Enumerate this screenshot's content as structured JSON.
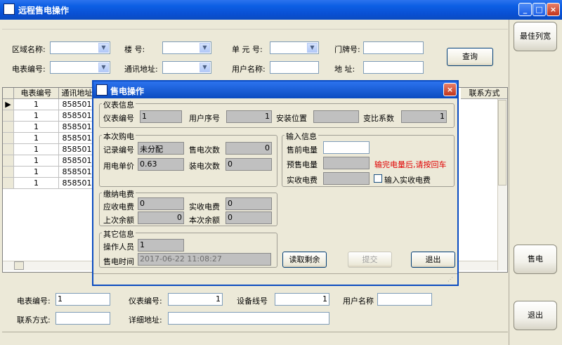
{
  "window": {
    "title": "远程售电操作"
  },
  "filters": {
    "area_label": "区域名称:",
    "building_label": "楼      号:",
    "unit_label": "单 元  号:",
    "door_label": "门牌号:",
    "meter_label": "电表编号:",
    "comm_label": "通讯地址:",
    "user_label": "用户名称:",
    "addr_label": "地    址:",
    "query_button": "查询"
  },
  "side": {
    "best_width": "最佳列宽",
    "sell": "售电",
    "exit": "退出"
  },
  "grid": {
    "headers": [
      "电表编号",
      "通讯地址",
      "联系方式"
    ],
    "rows": [
      [
        "1",
        "858501"
      ],
      [
        "1",
        "858501"
      ],
      [
        "1",
        "858501"
      ],
      [
        "1",
        "858501"
      ],
      [
        "1",
        "858501"
      ],
      [
        "1",
        "858501"
      ],
      [
        "1",
        "858501"
      ],
      [
        "1",
        "858501"
      ]
    ]
  },
  "bottom": {
    "meter_label": "电表编号:",
    "meter_value": "1",
    "instr_label": "仪表编号:",
    "instr_value": "1",
    "line_label": "设备线号",
    "line_value": "1",
    "user_label": "用户名称",
    "contact_label": "联系方式:",
    "address_label": "详细地址:"
  },
  "dialog": {
    "title": "售电操作",
    "meter_info": {
      "title": "仪表信息",
      "meter_no_label": "仪表编号",
      "meter_no": "1",
      "user_seq_label": "用户序号",
      "user_seq": "1",
      "location_label": "安装位置",
      "location": "",
      "ratio_label": "变比系数",
      "ratio": "1"
    },
    "purchase": {
      "title": "本次购电",
      "record_label": "记录编号",
      "record": "未分配",
      "sell_count_label": "售电次数",
      "sell_count": "0",
      "price_label": "用电单价",
      "price": "0.63",
      "install_count_label": "装电次数",
      "install_count": "0"
    },
    "input": {
      "title": "输入信息",
      "pre_label": "售前电量",
      "pre": "",
      "presale_label": "预售电量",
      "presale": "",
      "hint": "输完电量后,请按回车",
      "actual_fee_label": "实收电费",
      "actual_fee": "",
      "check_label": "输入实收电费"
    },
    "payment": {
      "title": "缴纳电费",
      "due_label": "应收电费",
      "due": "0",
      "received_label": "实收电费",
      "received": "0",
      "last_balance_label": "上次余额",
      "last_balance": "0",
      "this_balance_label": "本次余额",
      "this_balance": "0"
    },
    "other": {
      "title": "其它信息",
      "operator_label": "操作人员",
      "operator": "1",
      "time_label": "售电时间",
      "time": "2017-06-22 11:08:27"
    },
    "buttons": {
      "read": "读取剩余",
      "submit": "提交",
      "exit": "退出"
    }
  }
}
